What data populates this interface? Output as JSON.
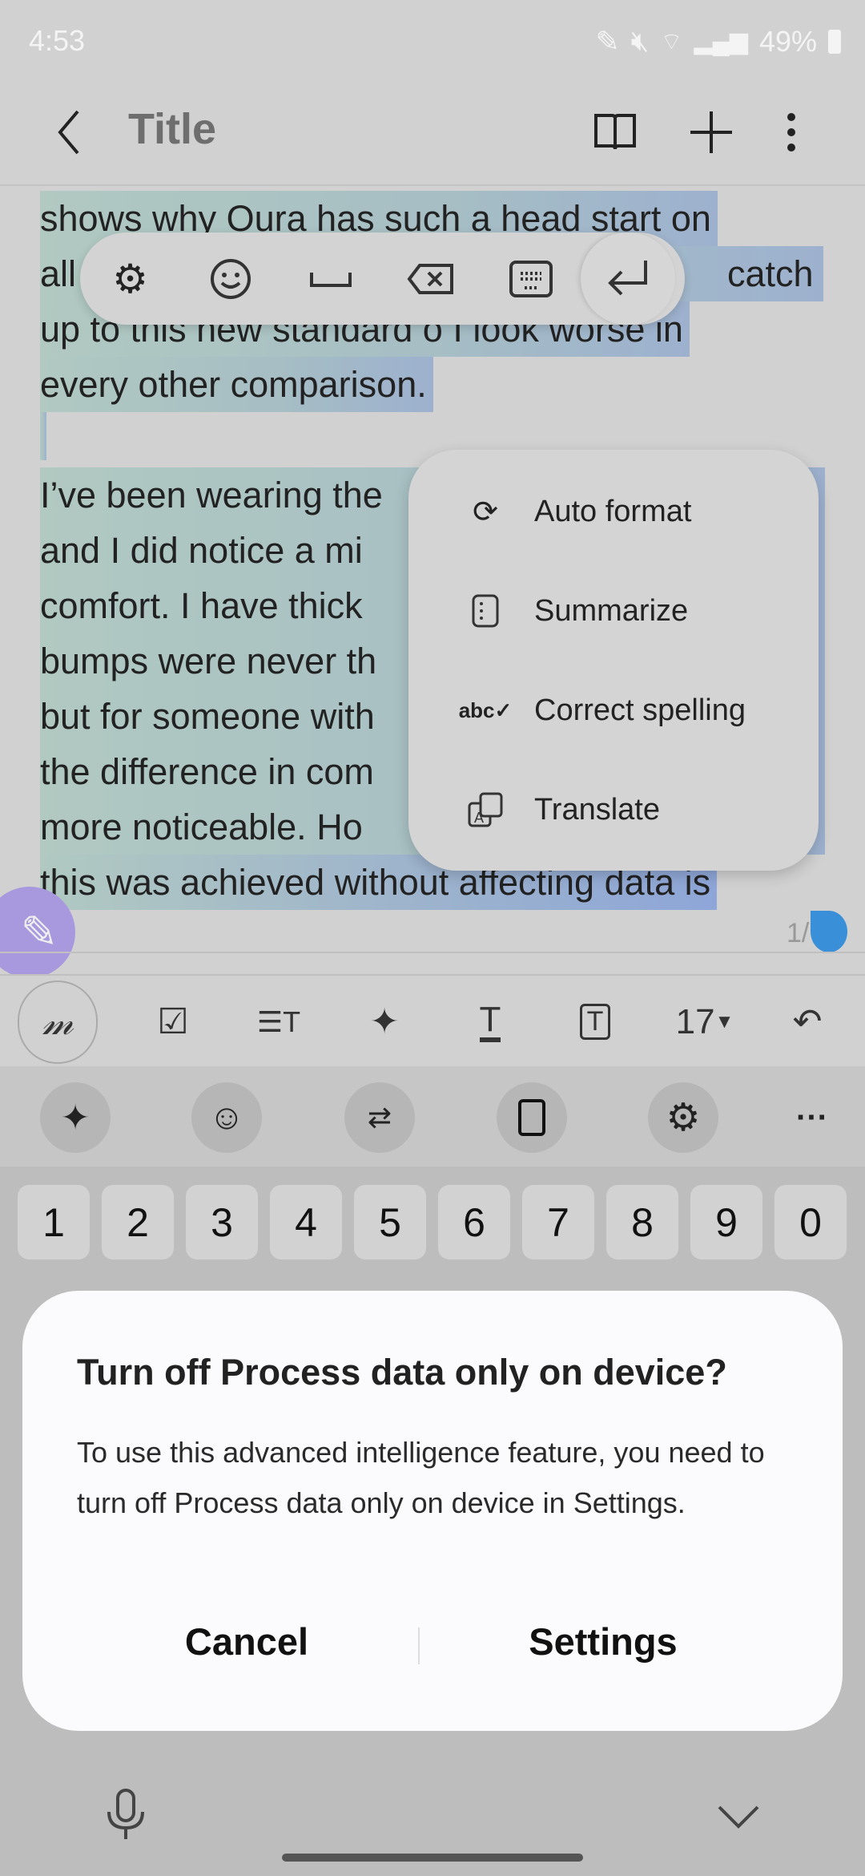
{
  "status_bar": {
    "time": "4:53",
    "battery": "49%"
  },
  "header": {
    "title": "Title"
  },
  "note": {
    "lines": [
      "shows why Oura has such a head start on",
      "all",
      "catch",
      "up to this new standard o I look worse in",
      "every other comparison.",
      "",
      "I’ve been wearing the",
      "and I did notice a mi",
      "comfort. I have thick",
      "bumps were never th",
      "but for someone with",
      "the difference in com",
      "more noticeable. Ho",
      "this was achieved without affecting data is"
    ],
    "page_indicator": "1/"
  },
  "floating_toolbar": {
    "icons": [
      "gear-icon",
      "emoji-icon",
      "space-icon",
      "backspace-icon",
      "keyboard-icon",
      "enter-icon"
    ]
  },
  "context_menu": {
    "items": [
      {
        "label": "Auto format",
        "icon": "auto-format-icon"
      },
      {
        "label": "Summarize",
        "icon": "summarize-icon"
      },
      {
        "label": "Correct spelling",
        "icon": "spellcheck-icon"
      },
      {
        "label": "Translate",
        "icon": "translate-icon"
      }
    ]
  },
  "format_toolbar": {
    "font_size": "17"
  },
  "keyboard": {
    "number_row": [
      "1",
      "2",
      "3",
      "4",
      "5",
      "6",
      "7",
      "8",
      "9",
      "0"
    ]
  },
  "dialog": {
    "title": "Turn off Process data only on device?",
    "body": "To use this advanced intelligence feature, you need to turn off Process data only on device in Settings.",
    "cancel": "Cancel",
    "settings": "Settings"
  },
  "colors": {
    "fab": "#a898de",
    "selection_handle": "#3a8fd9",
    "dialog_bg": "#fbfbfd"
  }
}
